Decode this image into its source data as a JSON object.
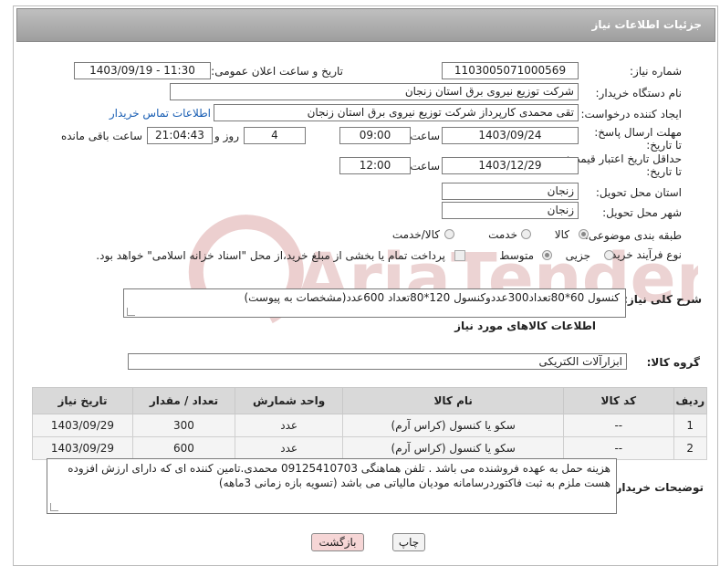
{
  "header": {
    "title": "جزئیات اطلاعات نیاز"
  },
  "form": {
    "need_number_label": "شماره نیاز:",
    "need_number": "1103005071000569",
    "announce_label": "تاریخ و ساعت اعلان عمومی:",
    "announce_value": "1403/09/19 - 11:30",
    "buyer_org_label": "نام دستگاه خریدار:",
    "buyer_org": "شرکت توزیع نیروی برق استان زنجان",
    "creator_label": "ایجاد کننده درخواست:",
    "creator": "تقی محمدی کارپرداز شرکت توزیع نیروی برق استان زنجان",
    "contact_link": "اطلاعات تماس خریدار",
    "reply_deadline_label": "مهلت ارسال پاسخ: تا تاریخ:",
    "reply_date": "1403/09/24",
    "time_label": "ساعت",
    "reply_time": "09:00",
    "days_value": "4",
    "days_label": "روز و",
    "remaining_time": "21:04:43",
    "remaining_label": "ساعت باقی مانده",
    "price_validity_label": "حداقل تاریخ اعتبار قیمت: تا تاریخ:",
    "price_date": "1403/12/29",
    "price_time": "12:00",
    "province_label": "استان محل تحویل:",
    "province": "زنجان",
    "city_label": "شهر محل تحویل:",
    "city": "زنجان",
    "category_label": "طبقه بندی موضوعی:",
    "category_options": [
      "کالا",
      "خدمت",
      "کالا/خدمت"
    ],
    "process_label": "نوع فرآیند خرید :",
    "process_options": [
      "جزیی",
      "متوسط"
    ],
    "payment_text": "پرداخت تمام یا بخشی از مبلغ خرید،از محل \"اسناد خزانه اسلامی\" خواهد بود.",
    "description_label": "شرح کلی نیاز:",
    "description": "کنسول 60*80تعداد300عددوکنسول 120*80تعداد 600عدد(مشخصات به پیوست)"
  },
  "goods": {
    "section_title": "اطلاعات کالاهای مورد نیاز",
    "group_label": "گروه کالا:",
    "group_value": "ابزارآلات الکتریکی",
    "columns": [
      "ردیف",
      "کد کالا",
      "نام کالا",
      "واحد شمارش",
      "تعداد / مقدار",
      "تاریخ نیاز"
    ],
    "rows": [
      [
        "1",
        "--",
        "سکو یا کنسول (کراس آرم)",
        "عدد",
        "300",
        "1403/09/29"
      ],
      [
        "2",
        "--",
        "سکو یا کنسول (کراس آرم)",
        "عدد",
        "600",
        "1403/09/29"
      ]
    ]
  },
  "notes": {
    "label": "توضیحات خریدار:",
    "text": "هزینه حمل به عهده فروشنده می باشد . تلفن هماهنگی 09125410703 محمدی.تامین کننده ای که دارای ارزش افزوده هست ملزم به ثبت فاکتوردرسامانه مودیان مالیاتی می باشد (تسویه بازه زمانی 3ماهه)"
  },
  "buttons": {
    "print": "چاپ",
    "back": "بازگشت"
  },
  "watermark": {
    "text": "AriaTender.neT"
  },
  "colors": {
    "header_bg": "#a8a8a8",
    "link": "#1a5fb4",
    "back_button_bg": "#f6d6d6",
    "watermark": "#e7c9c9"
  }
}
